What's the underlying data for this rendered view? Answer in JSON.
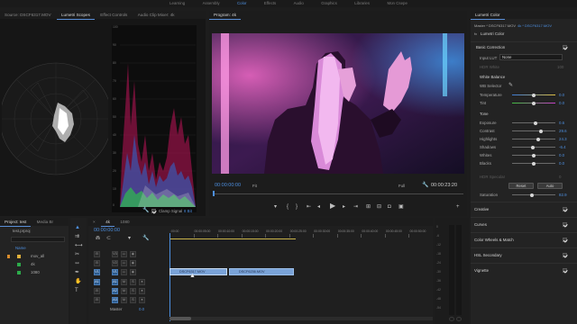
{
  "menubar": {
    "items": [
      "Learning",
      "Assembly",
      "Color",
      "Effects",
      "Audio",
      "Graphics",
      "Libraries",
      "Mon Csepe"
    ],
    "active_index": 2
  },
  "scopes_panel": {
    "tabs": [
      "Source: DSCF6317.MOV",
      "Lumetri Scopes",
      "Effect Controls",
      "Audio Clip Mixer: 4k"
    ],
    "active_tab_index": 1,
    "waveform_scale": [
      "100",
      "90",
      "80",
      "70",
      "60",
      "50",
      "40",
      "30",
      "20",
      "10",
      "0"
    ],
    "clamp_signal_label": "Clamp Signal",
    "clamp_signal_checked": true,
    "bit_label": "8 Bit"
  },
  "program_monitor": {
    "title": "Program: 4k",
    "timecode_current": "00:00:00:00",
    "fit_label": "Fit",
    "quality_label": "Full",
    "timecode_duration": "00:00:23:20"
  },
  "lumetri": {
    "panel_tab": "Lumetri Color",
    "source_line": "Master * DSCF6317.MOV",
    "sequence_line": "4k * DSCF6317.MOV",
    "fx_label": "fx",
    "effect_name": "Lumetri Color",
    "basic_correction": "Basic Correction",
    "input_lut_label": "Input LUT",
    "input_lut_value": "None",
    "hdr_white_label": "HDR White",
    "hdr_white_value": "100",
    "white_balance": "White Balance",
    "wb_selector": "WB Selector",
    "temperature_label": "Temperature",
    "temperature_value": "0.0",
    "temperature_pos": 0.5,
    "tint_label": "Tint",
    "tint_value": "0.0",
    "tint_pos": 0.5,
    "tone": "Tone",
    "tone_rows": [
      {
        "label": "Exposure",
        "value": "0.6",
        "pos": 0.55
      },
      {
        "label": "Contrast",
        "value": "29.6",
        "pos": 0.66
      },
      {
        "label": "Highlights",
        "value": "24.3",
        "pos": 0.61
      },
      {
        "label": "Shadows",
        "value": "-6.4",
        "pos": 0.47
      },
      {
        "label": "Whites",
        "value": "0.0",
        "pos": 0.5
      },
      {
        "label": "Blacks",
        "value": "0.0",
        "pos": 0.5
      }
    ],
    "hdr_specular_label": "HDR Specular",
    "hdr_specular_value": "0",
    "reset_label": "Reset",
    "auto_label": "Auto",
    "saturation_label": "Saturation",
    "saturation_value": "82.9",
    "saturation_pos": 0.45,
    "sections": [
      "Creative",
      "Curves",
      "Color Wheels & Match",
      "HSL Secondary",
      "Vignette"
    ]
  },
  "project_panel": {
    "tabs": [
      "Project: test",
      "Media Br"
    ],
    "project_file": "test.prproj",
    "name_header": "Name",
    "items": [
      "mov_all",
      "4k",
      "1080"
    ]
  },
  "timeline": {
    "tabs": [
      "4k",
      "1080"
    ],
    "active_tab_index": 0,
    "timecode": "00:00:00:00",
    "ruler_labels": [
      ":00:00",
      "00:00:05:00",
      "00:00:10:00",
      "00:00:15:00",
      "00:00:20:00",
      "00:00:25:00",
      "00:00:30:00",
      "00:00:35:00",
      "00:00:40:00",
      "00:00:45:00",
      "00:00:50:00"
    ],
    "video_tracks": [
      "V3",
      "V2",
      "V1"
    ],
    "audio_tracks": [
      "A1",
      "A2",
      "A3"
    ],
    "master_label": "Master",
    "master_value": "0.0",
    "clips": [
      "DSCF6317.MOV",
      "DSCF6236.MOV"
    ],
    "meter_labels": [
      "0",
      "-6",
      "-12",
      "-18",
      "-24",
      "-30",
      "-36",
      "-42",
      "-48",
      "-54"
    ]
  }
}
